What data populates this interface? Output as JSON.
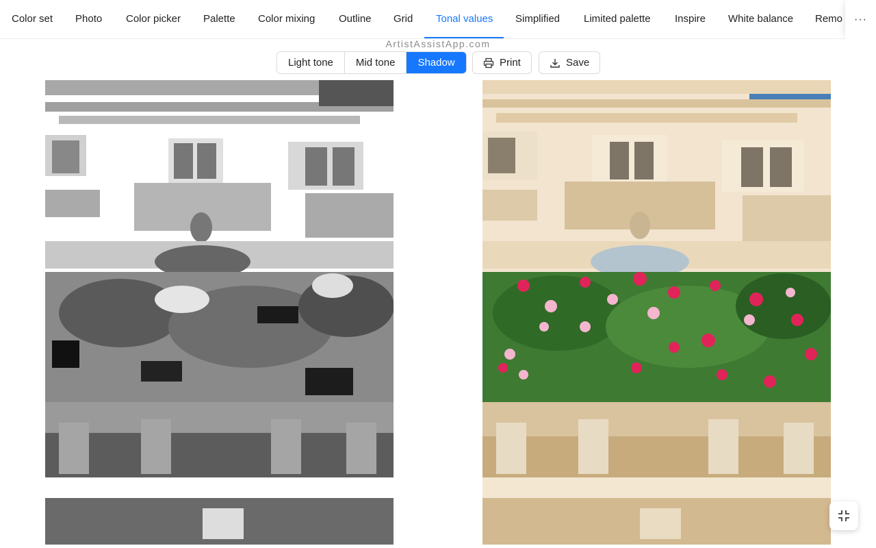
{
  "tabs": [
    {
      "label": "Color set",
      "active": false
    },
    {
      "label": "Photo",
      "active": false
    },
    {
      "label": "Color picker",
      "active": false
    },
    {
      "label": "Palette",
      "active": false
    },
    {
      "label": "Color mixing",
      "active": false
    },
    {
      "label": "Outline",
      "active": false
    },
    {
      "label": "Grid",
      "active": false
    },
    {
      "label": "Tonal values",
      "active": true
    },
    {
      "label": "Simplified",
      "active": false
    },
    {
      "label": "Limited palette",
      "active": false
    },
    {
      "label": "Inspire",
      "active": false
    },
    {
      "label": "White balance",
      "active": false
    },
    {
      "label": "Remo",
      "active": false
    }
  ],
  "more_label": "···",
  "watermark": "ArtistAssistApp.com",
  "tone_selector": {
    "options": [
      "Light tone",
      "Mid tone",
      "Shadow"
    ],
    "selected": "Shadow"
  },
  "actions": {
    "print_label": "Print",
    "save_label": "Save"
  },
  "colors": {
    "accent": "#1677ff"
  },
  "icons": {
    "print": "printer-icon",
    "save": "download-icon",
    "fullscreen": "fullscreen-exit-icon"
  }
}
